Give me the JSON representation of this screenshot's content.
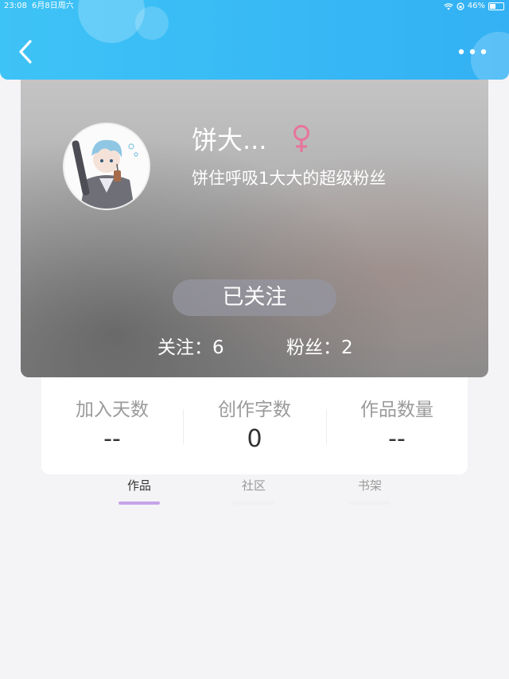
{
  "status_bar": {
    "time": "23:08",
    "date": "6月8日周六",
    "battery": "46%"
  },
  "nav": {
    "back_icon": "chevron-left-icon",
    "more_icon": "more-dots-icon"
  },
  "profile": {
    "nickname": "饼大...",
    "gender_icon": "female-symbol-icon",
    "gender_color": "#e8749a",
    "signature": "饼住呼吸1大大的超级粉丝",
    "follow_button": "已关注",
    "following_text": "关注：6",
    "followers_text": "粉丝：2"
  },
  "stats": [
    {
      "label": "加入天数",
      "value": "--"
    },
    {
      "label": "创作字数",
      "value": "0"
    },
    {
      "label": "作品数量",
      "value": "--"
    }
  ],
  "tabs": [
    {
      "label": "作品",
      "active": true
    },
    {
      "label": "社区",
      "active": false
    },
    {
      "label": "书架",
      "active": false
    }
  ],
  "colors": {
    "topbar": "#38b9f5",
    "accent_tab": "#c7a3ea",
    "background": "#f4f4f6"
  }
}
